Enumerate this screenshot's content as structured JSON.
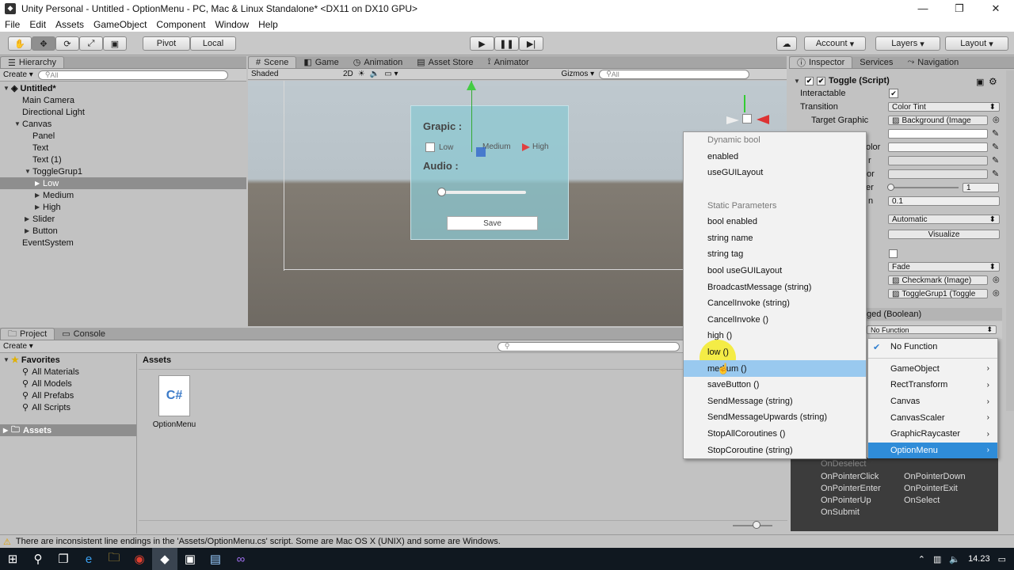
{
  "window": {
    "title": "Unity Personal - Untitled - OptionMenu - PC, Mac & Linux Standalone* <DX11 on DX10 GPU>"
  },
  "menubar": {
    "items": [
      "File",
      "Edit",
      "Assets",
      "GameObject",
      "Component",
      "Window",
      "Help"
    ]
  },
  "toolbar": {
    "pivot": "Pivot",
    "local": "Local",
    "account": "Account",
    "layers": "Layers",
    "layout": "Layout"
  },
  "hierarchy": {
    "tab": "Hierarchy",
    "create": "Create",
    "search_placeholder": "All",
    "scene": "Untitled*",
    "items": [
      {
        "label": "Main Camera"
      },
      {
        "label": "Directional Light"
      },
      {
        "label": "Canvas"
      },
      {
        "label": "Panel"
      },
      {
        "label": "Text"
      },
      {
        "label": "Text (1)"
      },
      {
        "label": "ToggleGrup1"
      },
      {
        "label": "Low"
      },
      {
        "label": "Medium"
      },
      {
        "label": "High"
      },
      {
        "label": "Slider"
      },
      {
        "label": "Button"
      },
      {
        "label": "EventSystem"
      }
    ]
  },
  "scene": {
    "tabs": [
      "Scene",
      "Game",
      "Animation",
      "Asset Store",
      "Animator"
    ],
    "shaded": "Shaded",
    "mode2d": "2D",
    "gizmos": "Gizmos",
    "search_placeholder": "All",
    "ui": {
      "graphic": "Grapic :",
      "low": "Low",
      "medium": "Medium",
      "high": "High",
      "audio": "Audio :",
      "save": "Save",
      "slider_value": 0.0
    }
  },
  "context_menu": {
    "items": [
      "Dynamic bool",
      "enabled",
      "useGUILayout",
      "",
      "Static Parameters",
      "bool enabled",
      "string name",
      "string tag",
      "bool useGUILayout",
      "BroadcastMessage (string)",
      "CancelInvoke (string)",
      "CancelInvoke ()",
      "high ()",
      "low ()",
      "medium ()",
      "saveButton ()",
      "SendMessage (string)",
      "SendMessageUpwards (string)",
      "StopAllCoroutines ()",
      "StopCoroutine (string)"
    ],
    "highlighted": "medium ()"
  },
  "function_menu": {
    "items": [
      "No Function",
      "GameObject",
      "RectTransform",
      "Canvas",
      "CanvasScaler",
      "GraphicRaycaster",
      "OptionMenu"
    ],
    "checked": "No Function",
    "highlighted": "OptionMenu"
  },
  "inspector": {
    "tabs": [
      "Inspector",
      "Services",
      "Navigation"
    ],
    "component": "Toggle (Script)",
    "interactable": "Interactable",
    "transition": "Transition",
    "transition_value": "Color Tint",
    "target_graphic": "Target Graphic",
    "target_graphic_value": "Background (Image",
    "frag_color": "olor",
    "frag_r1": "r",
    "frag_r2": "or",
    "frag_er": "er",
    "frag_n": "n",
    "multiplier_value": "1",
    "duration_value": "0.1",
    "navigation_value": "Automatic",
    "visualize": "Visualize",
    "toggle_transition_value": "Fade",
    "graphic_value": "Checkmark (Image)",
    "group_value": "ToggleGrup1 (Toggle",
    "event_header": "ged (Boolean)",
    "no_function": "No Function",
    "events": [
      "OnDeselect",
      "OnPointerClick",
      "OnPointerDown",
      "OnPointerEnter",
      "OnPointerExit",
      "OnPointerUp",
      "OnSelect",
      "OnSubmit"
    ]
  },
  "project": {
    "tabs": [
      "Project",
      "Console"
    ],
    "create": "Create",
    "favorites": "Favorites",
    "fav_items": [
      "All Materials",
      "All Models",
      "All Prefabs",
      "All Scripts"
    ],
    "assets_label": "Assets",
    "breadcrumb": "Assets",
    "file": "OptionMenu"
  },
  "status": {
    "message": "There are inconsistent line endings in the 'Assets/OptionMenu.cs' script. Some are Mac OS X (UNIX) and some are Windows."
  },
  "taskbar": {
    "time": "14.23"
  }
}
